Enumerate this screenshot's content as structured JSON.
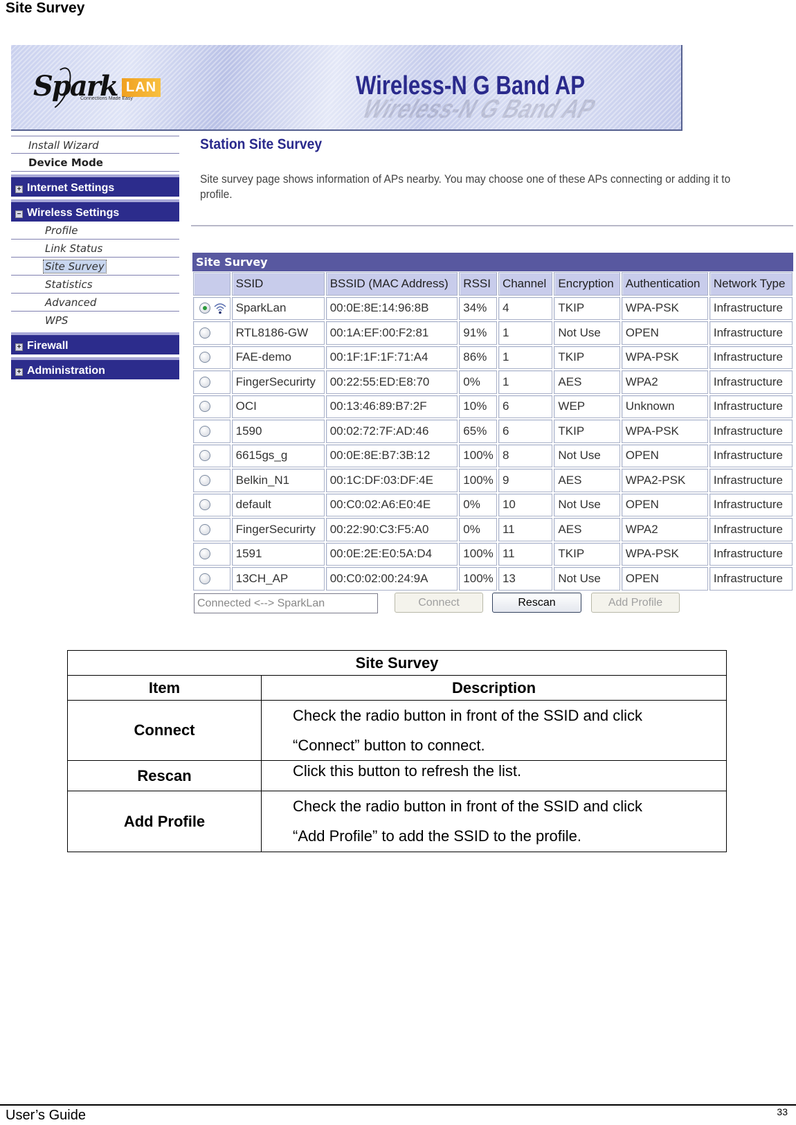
{
  "doc": {
    "section_title": "Site Survey",
    "footer_left": "User’s Guide",
    "page_number": "33"
  },
  "banner": {
    "logo_text": "Spark",
    "logo_badge": "LAN",
    "logo_tagline": "Connections Made Easy",
    "product_name": "Wireless-N G Band AP"
  },
  "sidebar": {
    "items": [
      {
        "label": "Install Wizard",
        "type": "link"
      },
      {
        "label": "Device Mode",
        "type": "link-bold"
      },
      {
        "label": "Internet Settings",
        "type": "section",
        "expanded": false
      },
      {
        "label": "Wireless Settings",
        "type": "section",
        "expanded": true
      },
      {
        "label": "Profile",
        "type": "child"
      },
      {
        "label": "Link Status",
        "type": "child"
      },
      {
        "label": "Site Survey",
        "type": "child",
        "selected": true
      },
      {
        "label": "Statistics",
        "type": "child"
      },
      {
        "label": "Advanced",
        "type": "child"
      },
      {
        "label": "WPS",
        "type": "child"
      },
      {
        "label": "Firewall",
        "type": "section",
        "expanded": false
      },
      {
        "label": "Administration",
        "type": "section",
        "expanded": false
      }
    ]
  },
  "content": {
    "title": "Station Site Survey",
    "description": "Site survey page shows information of APs nearby. You may choose one of these APs connecting or adding it to profile."
  },
  "survey": {
    "title": "Site Survey",
    "columns": [
      "",
      "SSID",
      "BSSID (MAC Address)",
      "RSSI",
      "Channel",
      "Encryption",
      "Authentication",
      "Network Type"
    ],
    "rows": [
      {
        "selected": true,
        "connected": true,
        "ssid": "SparkLan",
        "bssid": "00:0E:8E:14:96:8B",
        "rssi": "34%",
        "channel": "4",
        "encryption": "TKIP",
        "auth": "WPA-PSK",
        "type": "Infrastructure"
      },
      {
        "selected": false,
        "connected": false,
        "ssid": "RTL8186-GW",
        "bssid": "00:1A:EF:00:F2:81",
        "rssi": "91%",
        "channel": "1",
        "encryption": "Not Use",
        "auth": "OPEN",
        "type": "Infrastructure"
      },
      {
        "selected": false,
        "connected": false,
        "ssid": "FAE-demo",
        "bssid": "00:1F:1F:1F:71:A4",
        "rssi": "86%",
        "channel": "1",
        "encryption": "TKIP",
        "auth": "WPA-PSK",
        "type": "Infrastructure"
      },
      {
        "selected": false,
        "connected": false,
        "ssid": "FingerSecurirty",
        "bssid": "00:22:55:ED:E8:70",
        "rssi": "0%",
        "channel": "1",
        "encryption": "AES",
        "auth": "WPA2",
        "type": "Infrastructure"
      },
      {
        "selected": false,
        "connected": false,
        "ssid": "OCI",
        "bssid": "00:13:46:89:B7:2F",
        "rssi": "10%",
        "channel": "6",
        "encryption": "WEP",
        "auth": "Unknown",
        "type": "Infrastructure"
      },
      {
        "selected": false,
        "connected": false,
        "ssid": "1590",
        "bssid": "00:02:72:7F:AD:46",
        "rssi": "65%",
        "channel": "6",
        "encryption": "TKIP",
        "auth": "WPA-PSK",
        "type": "Infrastructure"
      },
      {
        "selected": false,
        "connected": false,
        "ssid": "6615gs_g",
        "bssid": "00:0E:8E:B7:3B:12",
        "rssi": "100%",
        "channel": "8",
        "encryption": "Not Use",
        "auth": "OPEN",
        "type": "Infrastructure"
      },
      {
        "selected": false,
        "connected": false,
        "ssid": "Belkin_N1",
        "bssid": "00:1C:DF:03:DF:4E",
        "rssi": "100%",
        "channel": "9",
        "encryption": "AES",
        "auth": "WPA2-PSK",
        "type": "Infrastructure"
      },
      {
        "selected": false,
        "connected": false,
        "ssid": "default",
        "bssid": "00:C0:02:A6:E0:4E",
        "rssi": "0%",
        "channel": "10",
        "encryption": "Not Use",
        "auth": "OPEN",
        "type": "Infrastructure"
      },
      {
        "selected": false,
        "connected": false,
        "ssid": "FingerSecurirty",
        "bssid": "00:22:90:C3:F5:A0",
        "rssi": "0%",
        "channel": "11",
        "encryption": "AES",
        "auth": "WPA2",
        "type": "Infrastructure"
      },
      {
        "selected": false,
        "connected": false,
        "ssid": "1591",
        "bssid": "00:0E:2E:E0:5A:D4",
        "rssi": "100%",
        "channel": "11",
        "encryption": "TKIP",
        "auth": "WPA-PSK",
        "type": "Infrastructure"
      },
      {
        "selected": false,
        "connected": false,
        "ssid": "13CH_AP",
        "bssid": "00:C0:02:00:24:9A",
        "rssi": "100%",
        "channel": "13",
        "encryption": "Not Use",
        "auth": "OPEN",
        "type": "Infrastructure"
      }
    ],
    "status_value": "Connected <--> SparkLan",
    "buttons": {
      "connect": "Connect",
      "rescan": "Rescan",
      "add_profile": "Add Profile"
    }
  },
  "doc_table": {
    "caption": "Site Survey",
    "headers": {
      "item": "Item",
      "description": "Description"
    },
    "rows": [
      {
        "item": "Connect",
        "description_lines": [
          "Check the radio button in front of the SSID and click",
          "“Connect” button to connect."
        ]
      },
      {
        "item": "Rescan",
        "description_lines": [
          "Click this button to refresh the list."
        ]
      },
      {
        "item": "Add Profile",
        "description_lines": [
          "Check the radio button in front of the SSID and click",
          "“Add Profile” to add the SSID to the profile."
        ]
      }
    ]
  },
  "colors": {
    "sidebar_section_bg": "#2c2c8c",
    "table_title_bg": "#5858a0",
    "table_header_bg": "#c8cceb",
    "content_title": "#2a2a8c"
  }
}
